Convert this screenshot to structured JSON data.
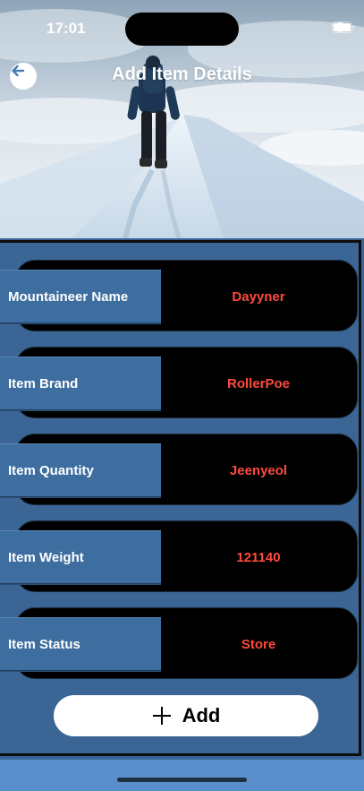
{
  "status_bar": {
    "time": "17:01"
  },
  "header": {
    "title": "Add Item Details"
  },
  "fields": [
    {
      "label": "Mountaineer Name",
      "value": "Dayyner"
    },
    {
      "label": "Item Brand",
      "value": "RollerPoe"
    },
    {
      "label": "Item Quantity",
      "value": "Jeenyeol"
    },
    {
      "label": "Item Weight",
      "value": "121140"
    },
    {
      "label": "Item Status",
      "value": "Store"
    }
  ],
  "actions": {
    "add_label": "Add"
  },
  "colors": {
    "panel_bg": "#3a6595",
    "label_bg": "#3e6e9f",
    "value_text": "#ff4a3d",
    "field_bg": "#000000",
    "page_bg": "#5b8fcb"
  },
  "icons": {
    "back": "arrow-left-icon",
    "add": "plus-icon",
    "wifi": "wifi-icon",
    "battery": "battery-icon",
    "signal": "signal-icon"
  }
}
